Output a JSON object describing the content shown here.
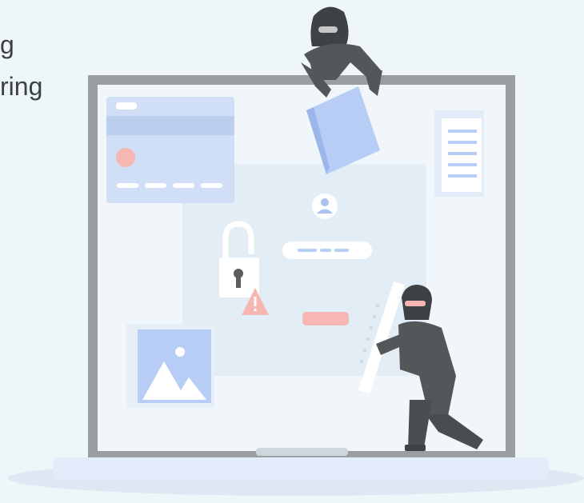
{
  "heading": {
    "line1": "g",
    "line2": "ring"
  },
  "illustration": {
    "icons": [
      "hacker-top-icon",
      "hacker-kneeling-icon",
      "padlock-icon",
      "warning-icon",
      "user-avatar-icon",
      "credit-card-icon",
      "document-icon",
      "image-placeholder-icon",
      "folder-icon",
      "laptop-icon"
    ],
    "colors": {
      "background": "#eef6f9",
      "laptop_frame": "#9a9ea2",
      "screen": "#f1f6fa",
      "panel": "#e5eef5",
      "accent_blue": "#b7cdf5",
      "accent_red": "#f6b6b2",
      "hacker": "#5a5c5f"
    }
  }
}
